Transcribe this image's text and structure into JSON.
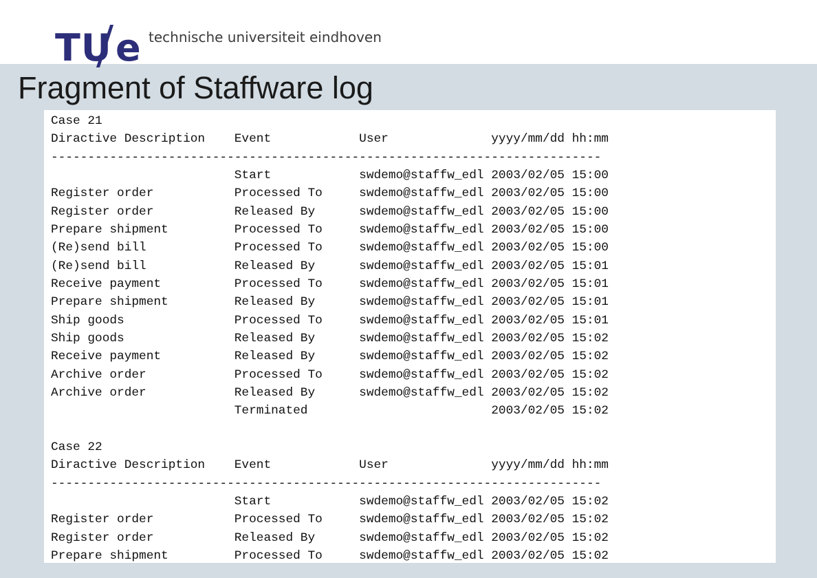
{
  "header": {
    "logo_text": "TU/e",
    "university": "technische universiteit eindhoven"
  },
  "slide": {
    "title": "Fragment of Staffware log"
  },
  "log": {
    "lines": [
      "Case 21",
      "Diractive Description    Event            User              yyyy/mm/dd hh:mm",
      "---------------------------------------------------------------------------",
      "                         Start            swdemo@staffw_edl 2003/02/05 15:00",
      "Register order           Processed To     swdemo@staffw_edl 2003/02/05 15:00",
      "Register order           Released By      swdemo@staffw_edl 2003/02/05 15:00",
      "Prepare shipment         Processed To     swdemo@staffw_edl 2003/02/05 15:00",
      "(Re)send bill            Processed To     swdemo@staffw_edl 2003/02/05 15:00",
      "(Re)send bill            Released By      swdemo@staffw_edl 2003/02/05 15:01",
      "Receive payment          Processed To     swdemo@staffw_edl 2003/02/05 15:01",
      "Prepare shipment         Released By      swdemo@staffw_edl 2003/02/05 15:01",
      "Ship goods               Processed To     swdemo@staffw_edl 2003/02/05 15:01",
      "Ship goods               Released By      swdemo@staffw_edl 2003/02/05 15:02",
      "Receive payment          Released By      swdemo@staffw_edl 2003/02/05 15:02",
      "Archive order            Processed To     swdemo@staffw_edl 2003/02/05 15:02",
      "Archive order            Released By      swdemo@staffw_edl 2003/02/05 15:02",
      "                         Terminated                         2003/02/05 15:02",
      "",
      "Case 22",
      "Diractive Description    Event            User              yyyy/mm/dd hh:mm",
      "---------------------------------------------------------------------------",
      "                         Start            swdemo@staffw_edl 2003/02/05 15:02",
      "Register order           Processed To     swdemo@staffw_edl 2003/02/05 15:02",
      "Register order           Released By      swdemo@staffw_edl 2003/02/05 15:02",
      "Prepare shipment         Processed To     swdemo@staffw_edl 2003/02/05 15:02"
    ]
  }
}
